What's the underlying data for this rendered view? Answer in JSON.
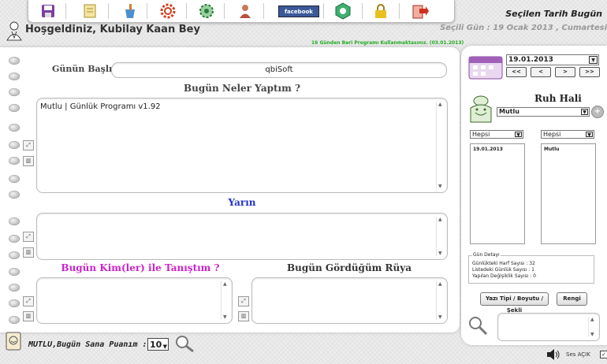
{
  "toolbar": {
    "icons": [
      "save-icon",
      "notes-icon",
      "cleaning-icon",
      "settings-gear-icon",
      "options-gear-icon",
      "users-icon",
      "facebook-icon",
      "refresh-icon",
      "lock-icon",
      "exit-icon"
    ],
    "facebook_label": "facebook"
  },
  "header": {
    "welcome": "Hoşgeldiniz, Kubilay Kaan Bey",
    "date_title": "Seçilen Tarih Bugün",
    "date_info": "Seçili Gün : 19 Ocak 2013 , Cumartesi",
    "days_used": "16 Günden Beri Programı Kullanmaktasınız. (03.01.2013)"
  },
  "main": {
    "day_title_label": "Günün Başlığı",
    "day_title_value": "qbiSoft",
    "today_heading": "Bugün Neler Yaptım ?",
    "today_text": "Mutlu | Günlük Programı v1.92",
    "tomorrow_heading": "Yarın",
    "met_heading": "Bugün Kim(ler) ile Tanıştım ?",
    "dream_heading": "Bugün Gördüğüm Rüya"
  },
  "bottom": {
    "rate_label": "MUTLU,Bugün Sana Puanım :",
    "rate_value": "10",
    "sound_label": "Ses AÇIK"
  },
  "right": {
    "date_value": "19.01.2013",
    "nav": [
      "<<",
      "<",
      ">",
      ">>"
    ],
    "mood_title": "Ruh Hali",
    "mood_value": "Mutlu",
    "filter_left": "Hepsi",
    "filter_right": "Hepsi",
    "list_left": [
      "19.01.2013"
    ],
    "list_right": [
      "Mutlu"
    ],
    "stats_legend": "Gün Detayı",
    "stats": [
      "Günlükteki Harf Sayısı : 32",
      "Listedeki Günlük Sayısı : 1",
      "Yapılan Değişiklik Sayısı : 0"
    ],
    "font_button": "Yazı Tipi / Boyutu / Şekli",
    "color_button": "Rengi"
  },
  "colors": {
    "accent_green": "#22aa22",
    "met_heading": "#cc22cc",
    "tomorrow_heading": "#2233cc"
  }
}
